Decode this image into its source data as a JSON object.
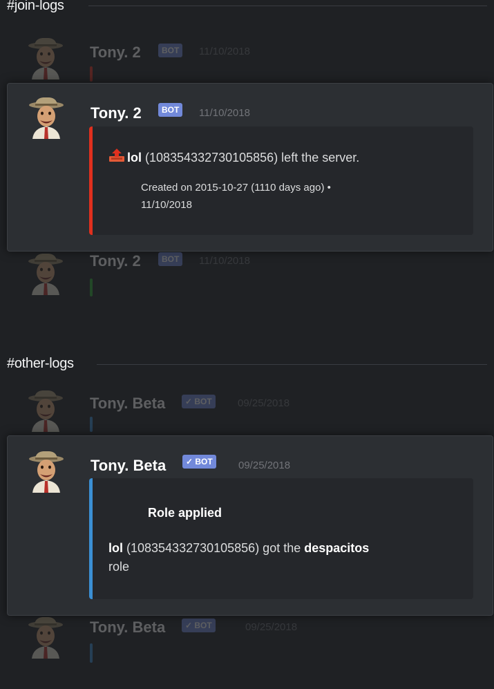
{
  "colors": {
    "bot_tag": "#7289da",
    "leave_bar": "#e0301e",
    "join_bar": "#2da931",
    "role_bar": "#3b8fd4"
  },
  "sections": [
    {
      "channel": "#join-logs"
    },
    {
      "channel": "#other-logs"
    }
  ],
  "join_logs": {
    "above": {
      "author": "Tony. 2",
      "tag": "BOT",
      "time": "11/10/2018"
    },
    "focus": {
      "author": "Tony. 2",
      "tag": "BOT",
      "time": "11/10/2018",
      "embed": {
        "icon": "leave-arrow-icon",
        "user": "lol",
        "rest": " (108354332730105856) left the server.",
        "footer_line1": "Created on 2015-10-27 (1110 days ago) •",
        "footer_line2": "11/10/2018"
      }
    },
    "below": {
      "author": "Tony. 2",
      "tag": "BOT",
      "time": "11/10/2018"
    }
  },
  "other_logs": {
    "above": {
      "author": "Tony. Beta",
      "tag": "✓ BOT",
      "time": "09/25/2018"
    },
    "focus": {
      "author": "Tony. Beta",
      "tag": "✓ BOT",
      "time": "09/25/2018",
      "embed": {
        "title": "Role applied",
        "user": "lol",
        "mid": " (108354332730105856) got the ",
        "role": "despacitos",
        "line2": "role"
      }
    },
    "below": {
      "author": "Tony. Beta",
      "tag": "✓ BOT",
      "time": "09/25/2018"
    }
  }
}
